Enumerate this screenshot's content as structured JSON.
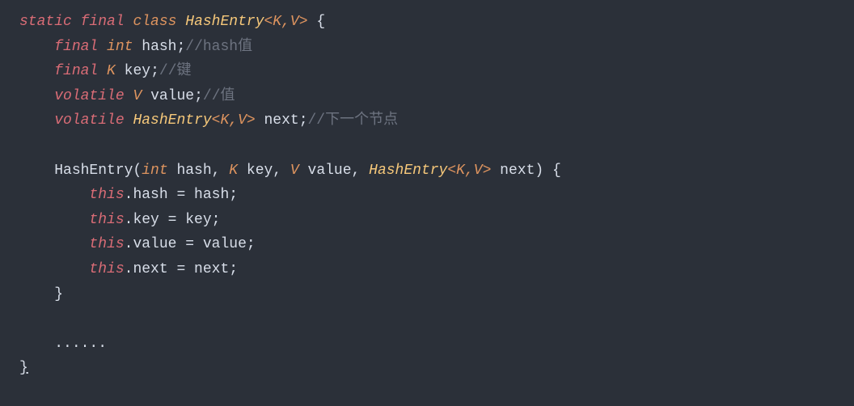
{
  "code": {
    "line1": {
      "static": "static",
      "final": "final",
      "class": "class",
      "name": "HashEntry",
      "generic": "<K,V>",
      "brace": " {"
    },
    "line2": {
      "final": "final",
      "int": "int",
      "ident": "hash;",
      "comment": "//hash值"
    },
    "line3": {
      "final": "final",
      "K": "K",
      "ident": "key;",
      "comment": "//键"
    },
    "line4": {
      "volatile": "volatile",
      "V": "V",
      "ident": "value;",
      "comment": "//值"
    },
    "line5": {
      "volatile": "volatile",
      "type": "HashEntry",
      "generic": "<K,V>",
      "ident": " next;",
      "comment": "//下一个节点"
    },
    "line6": {
      "ctor": "HashEntry(",
      "int": "int",
      "p1": " hash, ",
      "K": "K",
      "p2": " key, ",
      "V": "V",
      "p3": " value, ",
      "type": "HashEntry",
      "generic": "<K,V>",
      "p4": " next) ",
      "brace": "{"
    },
    "line7": {
      "this": "this",
      "rest": ".hash = hash;"
    },
    "line8": {
      "this": "this",
      "rest": ".key = key;"
    },
    "line9": {
      "this": "this",
      "rest": ".value = value;"
    },
    "line10": {
      "this": "this",
      "rest": ".next = next;"
    },
    "line11": "}",
    "line12": "......",
    "line13": "}"
  }
}
